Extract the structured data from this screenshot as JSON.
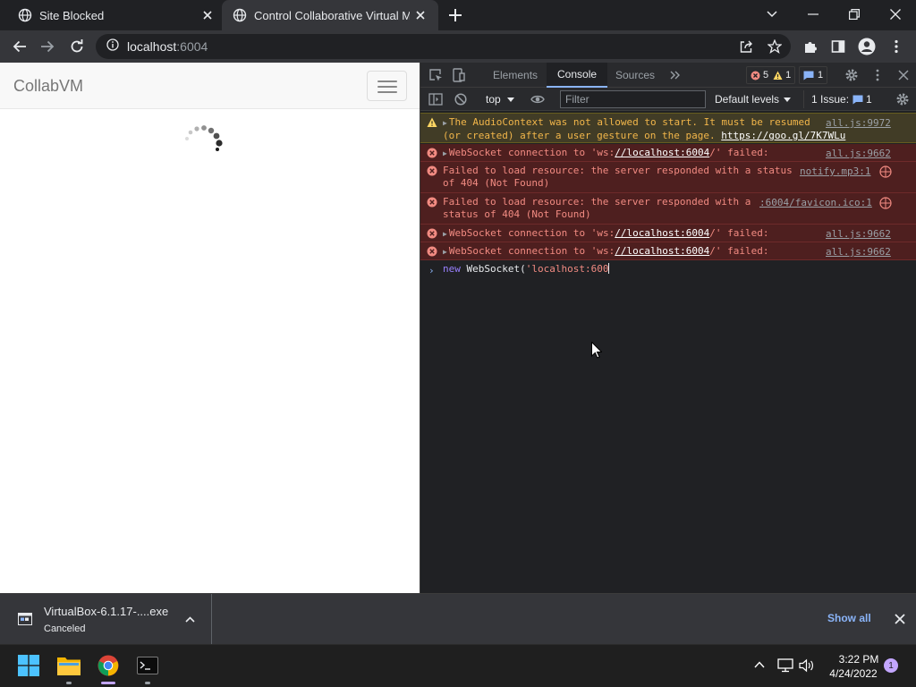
{
  "browser": {
    "tabs": [
      {
        "title": "Site Blocked",
        "favicon": "globe-icon",
        "active": false
      },
      {
        "title": "Control Collaborative Virtual Mac",
        "favicon": "globe-icon",
        "active": true
      }
    ],
    "address": {
      "host": "localhost",
      "port": ":6004"
    }
  },
  "page": {
    "brand": "CollabVM"
  },
  "devtools": {
    "tabs": [
      "Elements",
      "Console",
      "Sources"
    ],
    "active_tab": "Console",
    "error_count": "5",
    "warning_count": "1",
    "message_count": "1",
    "context": "top",
    "filter_placeholder": "Filter",
    "levels": "Default levels",
    "issues_label": "1 Issue:",
    "issues_count": "1",
    "messages": [
      {
        "level": "warning",
        "text1": "The AudioContext was not allowed to start. It must be resumed",
        "text2": "(or created) after a user gesture on the page.",
        "link": "https://goo.gl/7K7WLu",
        "source": "all.js:9972"
      },
      {
        "level": "error",
        "pre": "WebSocket connection to 'ws:",
        "link": "//localhost:6004",
        "post": "/' failed:",
        "source": "all.js:9662"
      },
      {
        "level": "error",
        "text1": "Failed to load resource: the server responded with a status",
        "text2": "of 404 (Not Found)",
        "source": "notify.mp3:1"
      },
      {
        "level": "error",
        "text1": "Failed to load resource: the server responded with a",
        "text2": "status of 404 (Not Found)",
        "source": ":6004/favicon.ico:1"
      },
      {
        "level": "error",
        "pre": "WebSocket connection to 'ws:",
        "link": "//localhost:6004",
        "post": "/' failed:",
        "source": "all.js:9662"
      },
      {
        "level": "error",
        "pre": "WebSocket connection to 'ws:",
        "link": "//localhost:6004",
        "post": "/' failed:",
        "source": "all.js:9662"
      }
    ],
    "prompt": {
      "kw": "new",
      "mid": " WebSocket(",
      "str": "'localhost:600"
    }
  },
  "download": {
    "filename": "VirtualBox-6.1.17-....exe",
    "status": "Canceled",
    "show_all": "Show all"
  },
  "taskbar": {
    "time": "3:22 PM",
    "date": "4/24/2022",
    "notifications": "1"
  }
}
